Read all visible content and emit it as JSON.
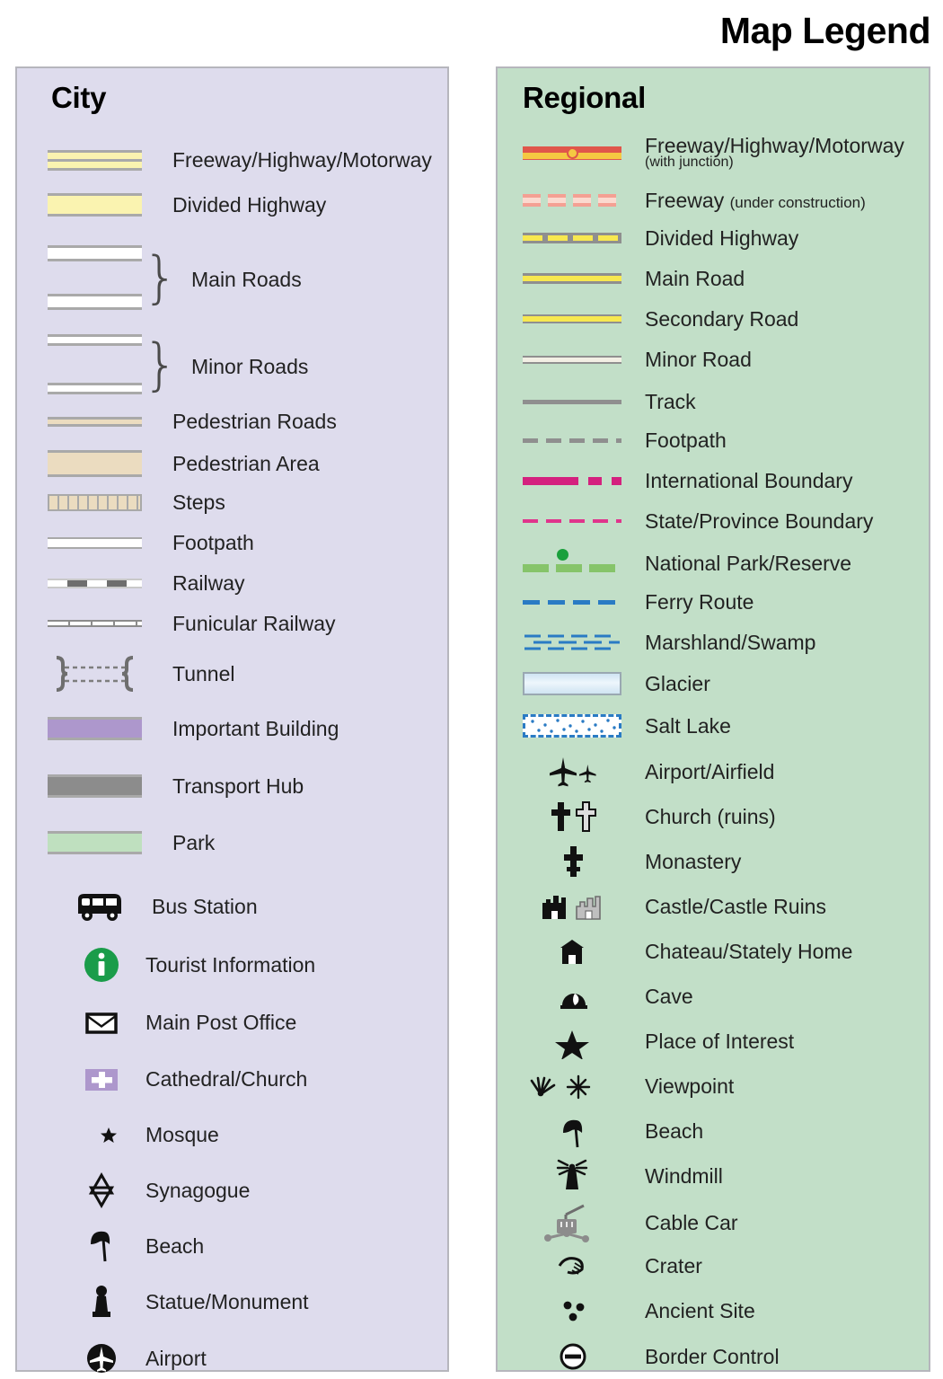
{
  "title": "Map Legend",
  "colors": {
    "city_panel_bg": "#dedced",
    "regional_panel_bg": "#c2dfc8",
    "panel_border": "#b6b6bd",
    "road_casing": "#a9a9a9",
    "highway_yellow": "#faf3b0",
    "pedestrian_tan": "#ebdcc0",
    "important_building": "#ad97cc",
    "transport_hub": "#8c8c8c",
    "park_green": "#bfe0bf",
    "tourist_info_green": "#1a9c4a",
    "freeway_red": "#e0564b",
    "freeway_yellow": "#f5c842",
    "construction_pink": "#f4a093",
    "road_yellow": "#f7e850",
    "road_gray": "#8f8f8f",
    "minor_cream": "#f2efe4",
    "international_magenta": "#d4217e",
    "state_pink": "#e0348c",
    "park_line_green": "#86c46a",
    "park_dot_green": "#1aa03c",
    "ferry_blue": "#2a7bc4",
    "glacier_blue": "#cfe4f2"
  },
  "city": {
    "title": "City",
    "items": [
      {
        "label": "Freeway/Highway/Motorway",
        "icon": "freeway-double-bar-symbol"
      },
      {
        "label": "Divided Highway",
        "icon": "divided-highway-bar-symbol"
      },
      {
        "label": "Main Roads",
        "icon": "main-roads-bracket-symbol"
      },
      {
        "label": "Minor Roads",
        "icon": "minor-roads-bracket-symbol"
      },
      {
        "label": "Pedestrian Roads",
        "icon": "pedestrian-road-bar-symbol"
      },
      {
        "label": "Pedestrian Area",
        "icon": "pedestrian-area-bar-symbol"
      },
      {
        "label": "Steps",
        "icon": "steps-symbol"
      },
      {
        "label": "Footpath",
        "icon": "footpath-line-symbol"
      },
      {
        "label": "Railway",
        "icon": "railway-dashed-symbol"
      },
      {
        "label": "Funicular Railway",
        "icon": "funicular-railway-symbol"
      },
      {
        "label": "Tunnel",
        "icon": "tunnel-bracket-symbol"
      },
      {
        "label": "Important Building",
        "icon": "important-building-swatch"
      },
      {
        "label": "Transport Hub",
        "icon": "transport-hub-swatch"
      },
      {
        "label": "Park",
        "icon": "park-swatch"
      },
      {
        "label": "Bus Station",
        "icon": "bus-icon"
      },
      {
        "label": "Tourist Information",
        "icon": "information-icon"
      },
      {
        "label": "Main Post Office",
        "icon": "envelope-icon"
      },
      {
        "label": "Cathedral/Church",
        "icon": "cross-on-purple-icon"
      },
      {
        "label": "Mosque",
        "icon": "crescent-star-icon"
      },
      {
        "label": "Synagogue",
        "icon": "star-of-david-icon"
      },
      {
        "label": "Beach",
        "icon": "beach-umbrella-icon"
      },
      {
        "label": "Statue/Monument",
        "icon": "statue-icon"
      },
      {
        "label": "Airport",
        "icon": "airplane-circle-icon"
      }
    ]
  },
  "regional": {
    "title": "Regional",
    "items": [
      {
        "label": "Freeway/Highway/Motorway",
        "sub": "(with junction)",
        "icon": "freeway-junction-line-symbol"
      },
      {
        "label": "Freeway",
        "sub_inline": "(under construction)",
        "icon": "freeway-construction-line-symbol"
      },
      {
        "label": "Divided Highway",
        "icon": "divided-highway-line-symbol"
      },
      {
        "label": "Main Road",
        "icon": "main-road-line-symbol"
      },
      {
        "label": "Secondary Road",
        "icon": "secondary-road-line-symbol"
      },
      {
        "label": "Minor Road",
        "icon": "minor-road-line-symbol"
      },
      {
        "label": "Track",
        "icon": "track-line-symbol"
      },
      {
        "label": "Footpath",
        "icon": "footpath-dashed-line-symbol"
      },
      {
        "label": "International Boundary",
        "icon": "international-boundary-line-symbol"
      },
      {
        "label": "State/Province Boundary",
        "icon": "state-boundary-line-symbol"
      },
      {
        "label": "National Park/Reserve",
        "icon": "national-park-line-symbol"
      },
      {
        "label": "Ferry Route",
        "icon": "ferry-route-line-symbol"
      },
      {
        "label": "Marshland/Swamp",
        "icon": "marshland-symbol"
      },
      {
        "label": "Glacier",
        "icon": "glacier-swatch"
      },
      {
        "label": "Salt Lake",
        "icon": "salt-lake-swatch"
      },
      {
        "label": "Airport/Airfield",
        "icon": "airplane-pair-icon"
      },
      {
        "label": "Church (ruins)",
        "icon": "cross-pair-icon"
      },
      {
        "label": "Monastery",
        "icon": "orthodox-cross-icon"
      },
      {
        "label": "Castle/Castle Ruins",
        "icon": "castle-pair-icon"
      },
      {
        "label": "Chateau/Stately Home",
        "icon": "chateau-icon"
      },
      {
        "label": "Cave",
        "icon": "cave-icon"
      },
      {
        "label": "Place of Interest",
        "icon": "star-icon"
      },
      {
        "label": "Viewpoint",
        "icon": "viewpoint-pair-icon"
      },
      {
        "label": "Beach",
        "icon": "beach-umbrella-icon"
      },
      {
        "label": "Windmill",
        "icon": "windmill-icon"
      },
      {
        "label": "Cable Car",
        "icon": "cable-car-icon"
      },
      {
        "label": "Crater",
        "icon": "crater-icon"
      },
      {
        "label": "Ancient Site",
        "icon": "ancient-site-dots-icon"
      },
      {
        "label": "Border Control",
        "icon": "border-control-icon"
      }
    ]
  }
}
